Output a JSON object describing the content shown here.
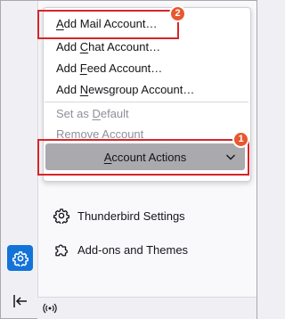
{
  "menu": {
    "items": [
      {
        "pre": "",
        "key": "A",
        "post": "dd Mail Account…"
      },
      {
        "pre": "Add ",
        "key": "C",
        "post": "hat Account…"
      },
      {
        "pre": "Add ",
        "key": "F",
        "post": "eed Account…"
      },
      {
        "pre": "Add ",
        "key": "N",
        "post": "ewsgroup Account…"
      },
      {
        "pre": "Set as ",
        "key": "D",
        "post": "efault"
      },
      {
        "pre": "",
        "key": "R",
        "post": "emove Account"
      }
    ]
  },
  "actions_button": {
    "pre": "",
    "key": "A",
    "post": "ccount Actions"
  },
  "badges": {
    "first": "1",
    "second": "2"
  },
  "side_items": {
    "settings": "Thunderbird Settings",
    "addons": "Add-ons and Themes"
  },
  "icons": {
    "settings_space": "gear-icon",
    "collapse": "collapse-left-icon",
    "status": "wifi-status-icon",
    "addons": "puzzle-icon",
    "dropdown": "chevron-down-icon"
  },
  "colors": {
    "highlight": "#d9242a",
    "badge": "#e8572f",
    "active_space": "#1373d9",
    "button_pressed": "#a9a9ae"
  }
}
